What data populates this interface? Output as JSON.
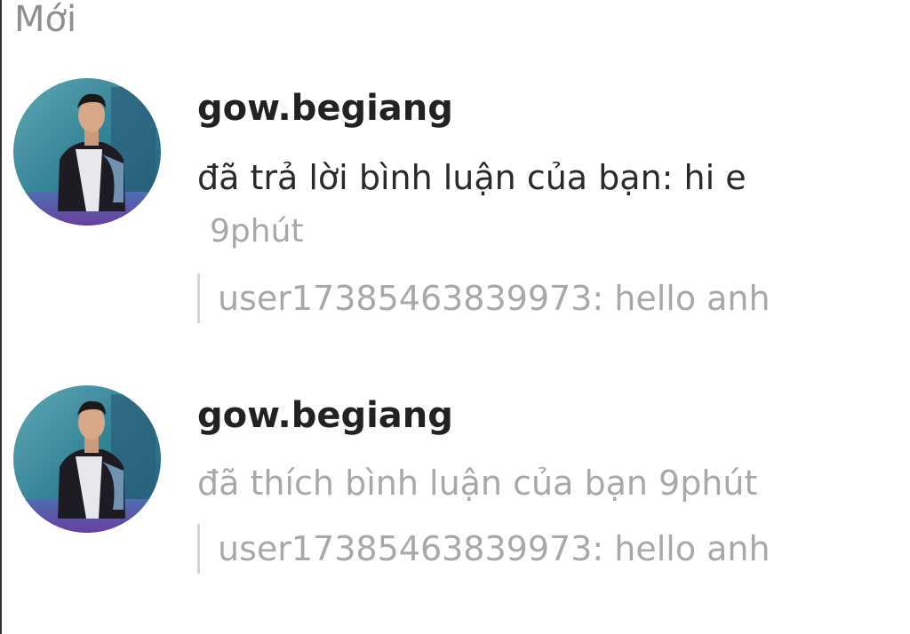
{
  "section": {
    "title": "Mới"
  },
  "notifications": [
    {
      "username": "gow.begiang",
      "action": "đã trả lời bình luận của bạn: hi e",
      "time": "9phút",
      "quoted_comment": "user17385463839973: hello anh",
      "avatar_icon": "user-avatar-photo"
    },
    {
      "username": "gow.begiang",
      "action": "đã thích bình luận của bạn 9phút",
      "quoted_comment": "user17385463839973: hello anh",
      "avatar_icon": "user-avatar-photo"
    }
  ],
  "colors": {
    "title": "#8f8f8f",
    "username": "#222222",
    "muted": "#a8a8a8",
    "quote_bar": "#d4d4d4"
  }
}
